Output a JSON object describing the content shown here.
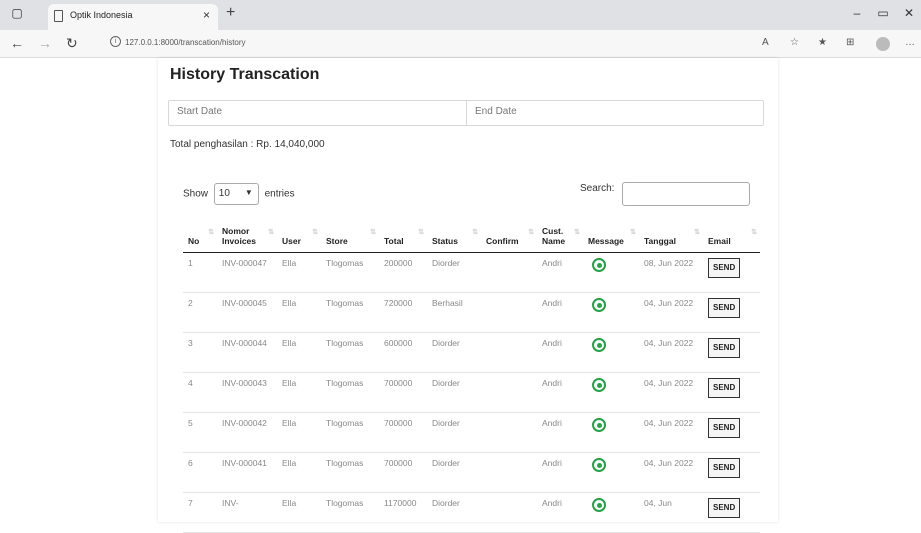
{
  "browser": {
    "tab_title": "Optik Indonesia",
    "tab_close": "×",
    "new_tab": "+",
    "url": "127.0.0.1:8000/transcation/history"
  },
  "page": {
    "title": "History Transcation",
    "start_date_placeholder": "Start Date",
    "end_date_placeholder": "End Date",
    "total_text": "Total penghasilan : Rp. 14,040,000"
  },
  "entries": {
    "show_label": "Show",
    "selected": "10",
    "entries_label": "entries",
    "search_label": "Search:"
  },
  "table": {
    "headers": [
      "No",
      "Nomor Invoices",
      "User",
      "Store",
      "Total",
      "Status",
      "Confirm",
      "Cust. Name",
      "Message",
      "Tanggal",
      "Email"
    ],
    "rows": [
      {
        "no": "1",
        "invoice": "INV-000047",
        "user": "Ella",
        "store": "Tlogomas",
        "total": "200000",
        "status": "Diorder",
        "confirm": "",
        "cust": "Andri",
        "tanggal": "08, Jun 2022",
        "email": "SEND"
      },
      {
        "no": "2",
        "invoice": "INV-000045",
        "user": "Ella",
        "store": "Tlogomas",
        "total": "720000",
        "status": "Berhasil",
        "confirm": "",
        "cust": "Andri",
        "tanggal": "04, Jun 2022",
        "email": "SEND"
      },
      {
        "no": "3",
        "invoice": "INV-000044",
        "user": "Ella",
        "store": "Tlogomas",
        "total": "600000",
        "status": "Diorder",
        "confirm": "",
        "cust": "Andri",
        "tanggal": "04, Jun 2022",
        "email": "SEND"
      },
      {
        "no": "4",
        "invoice": "INV-000043",
        "user": "Ella",
        "store": "Tlogomas",
        "total": "700000",
        "status": "Diorder",
        "confirm": "",
        "cust": "Andri",
        "tanggal": "04, Jun 2022",
        "email": "SEND"
      },
      {
        "no": "5",
        "invoice": "INV-000042",
        "user": "Ella",
        "store": "Tlogomas",
        "total": "700000",
        "status": "Diorder",
        "confirm": "",
        "cust": "Andri",
        "tanggal": "04, Jun 2022",
        "email": "SEND"
      },
      {
        "no": "6",
        "invoice": "INV-000041",
        "user": "Ella",
        "store": "Tlogomas",
        "total": "700000",
        "status": "Diorder",
        "confirm": "",
        "cust": "Andri",
        "tanggal": "04, Jun 2022",
        "email": "SEND"
      },
      {
        "no": "7",
        "invoice": "INV-",
        "user": "Ella",
        "store": "Tlogomas",
        "total": "1170000",
        "status": "Diorder",
        "confirm": "",
        "cust": "Andri",
        "tanggal": "04, Jun",
        "email": "SEND"
      }
    ]
  },
  "icons": {
    "message": "whatsapp-icon",
    "select_chevron": "chevron-down-icon"
  },
  "colors": {
    "whatsapp": "#25a244"
  }
}
